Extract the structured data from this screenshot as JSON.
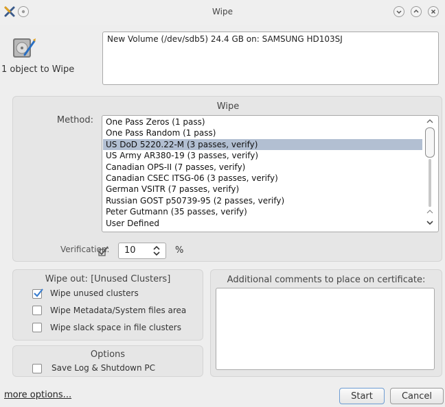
{
  "window": {
    "title": "Wipe"
  },
  "source": {
    "objects_label": "1 object to Wipe",
    "target_text": "New Volume (/dev/sdb5) 24.4 GB on: SAMSUNG HD103SJ"
  },
  "wipe_group": {
    "title": "Wipe",
    "method_label": "Method:",
    "methods": [
      "One Pass Zeros (1 pass)",
      "One Pass Random (1 pass)",
      "US DoD 5220.22-M (3 passes, verify)",
      "US Army AR380-19 (3 passes, verify)",
      "Canadian OPS-II (7 passes, verify)",
      "Canadian CSEC ITSG-06 (3 passes, verify)",
      "German VSITR (7 passes, verify)",
      "Russian GOST p50739-95 (2 passes, verify)",
      "Peter Gutmann (35 passes, verify)",
      "User Defined"
    ],
    "selected_index": 2,
    "verification_label": "Verification:",
    "verification_value": "10",
    "verification_unit": "%"
  },
  "wipe_out": {
    "title": "Wipe out: [Unused Clusters]",
    "options": [
      {
        "label": "Wipe unused clusters",
        "checked": true
      },
      {
        "label": "Wipe Metadata/System files area",
        "checked": false
      },
      {
        "label": "Wipe slack space in file clusters",
        "checked": false
      }
    ]
  },
  "options_group": {
    "title": "Options",
    "save_log_label": "Save Log & Shutdown PC",
    "save_log_checked": false
  },
  "comments": {
    "title": "Additional comments to place on certificate:",
    "value": ""
  },
  "footer": {
    "more_options": "more options...",
    "start": "Start",
    "cancel": "Cancel"
  },
  "colors": {
    "selection": "#b2bfd2",
    "check_accent": "#3a7ecf",
    "primary_border": "#6d9cd2"
  }
}
